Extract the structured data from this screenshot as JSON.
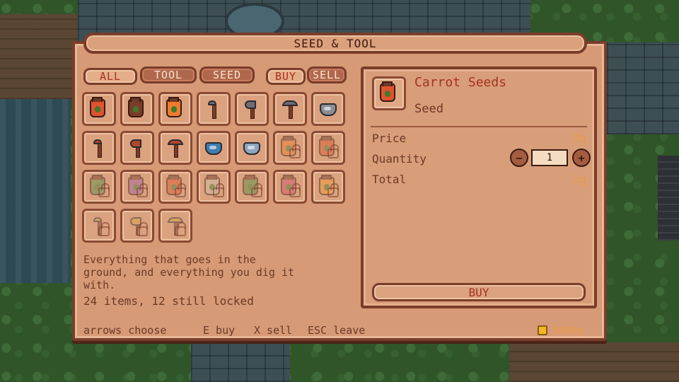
{
  "title": "SEED & TOOL",
  "tabs": {
    "all": "ALL",
    "tool": "TOOL",
    "seed": "SEED",
    "buy": "BUY",
    "sell": "SELL"
  },
  "description": "Everything that goes in the\nground, and everything you dig it\nwith.",
  "count_text": "24 items, 12 still locked",
  "selected": {
    "name": "Carrot Seeds",
    "type": "Seed",
    "price_label": "Price",
    "price": "3g",
    "quantity_label": "Quantity",
    "quantity": "1",
    "total_label": "Total",
    "total": "3g",
    "buy_label": "BUY",
    "minus": "−",
    "plus": "+"
  },
  "footer": {
    "choose": "arrows choose",
    "buy": "E buy",
    "sell": "X sell",
    "leave": "ESC leave",
    "gold": "3000g"
  },
  "items": [
    {
      "kind": "jar",
      "color": "#e0532d",
      "icon": "carrot-seed-jar-icon",
      "locked": false
    },
    {
      "kind": "jar",
      "color": "#7a3d2a",
      "icon": "brown-seed-jar-icon",
      "locked": false
    },
    {
      "kind": "jar",
      "color": "#ef7b2f",
      "icon": "flame-seed-jar-icon",
      "locked": false
    },
    {
      "kind": "hoe",
      "color": "#6d6e73",
      "icon": "hoe-icon",
      "locked": false
    },
    {
      "kind": "axe",
      "color": "#6d6e73",
      "icon": "axe-icon",
      "locked": false
    },
    {
      "kind": "pickaxe",
      "color": "#6d6e73",
      "icon": "pickaxe-icon",
      "locked": false
    },
    {
      "kind": "can",
      "color": "#8a8e94",
      "icon": "watering-can-icon",
      "locked": false
    },
    {
      "kind": "hoe",
      "color": "#b0482a",
      "icon": "copper-hoe-icon",
      "locked": false
    },
    {
      "kind": "axe",
      "color": "#b0482a",
      "icon": "copper-axe-icon",
      "locked": false
    },
    {
      "kind": "pickaxe",
      "color": "#b0482a",
      "icon": "copper-pickaxe-icon",
      "locked": false
    },
    {
      "kind": "can",
      "color": "#3f7fae",
      "icon": "blue-watering-can-icon",
      "locked": false
    },
    {
      "kind": "can",
      "color": "#8ea6bd",
      "icon": "silver-watering-can-icon",
      "locked": false
    },
    {
      "kind": "jar",
      "color": "#ef7b2f",
      "icon": "orange-seed-jar-icon",
      "locked": true
    },
    {
      "kind": "jar",
      "color": "#e0532d",
      "icon": "red-seed-jar-icon",
      "locked": true
    },
    {
      "kind": "jar",
      "color": "#4f8f44",
      "icon": "green-seed-jar-icon",
      "locked": true
    },
    {
      "kind": "jar",
      "color": "#a35fae",
      "icon": "purple-seed-jar-icon",
      "locked": true
    },
    {
      "kind": "jar",
      "color": "#e0532d",
      "icon": "tomato-seed-jar-icon",
      "locked": true
    },
    {
      "kind": "jar",
      "color": "#c9c1a8",
      "icon": "white-seed-jar-icon",
      "locked": true
    },
    {
      "kind": "jar",
      "color": "#4f8f44",
      "icon": "herb-seed-jar-icon",
      "locked": true
    },
    {
      "kind": "jar",
      "color": "#d8506a",
      "icon": "berry-seed-jar-icon",
      "locked": true
    },
    {
      "kind": "jar",
      "color": "#ef9a2f",
      "icon": "pumpkin-seed-jar-icon",
      "locked": true
    },
    {
      "kind": "hoe",
      "color": "#d7a23c",
      "icon": "gold-hoe-icon",
      "locked": true
    },
    {
      "kind": "axe",
      "color": "#d7a23c",
      "icon": "gold-axe-icon",
      "locked": true
    },
    {
      "kind": "pickaxe",
      "color": "#d7a23c",
      "icon": "gold-pickaxe-icon",
      "locked": true
    }
  ]
}
